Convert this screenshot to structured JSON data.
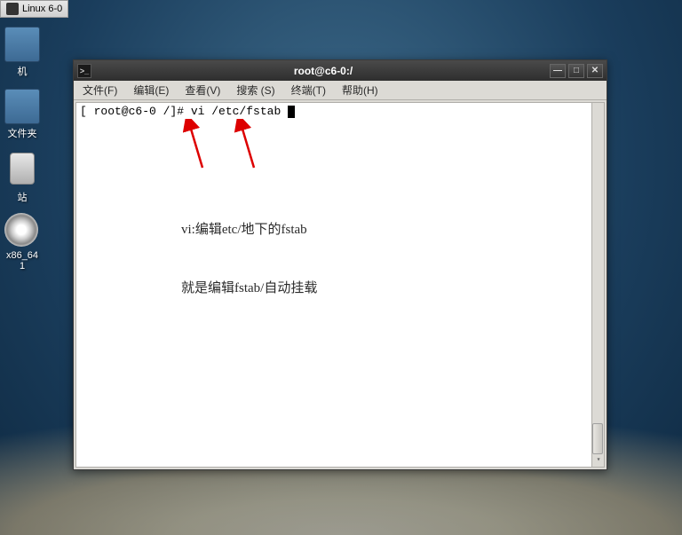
{
  "taskbar": {
    "item": "Linux 6-0"
  },
  "desktop": {
    "icons": {
      "computer": "机",
      "folder": "文件夹",
      "trash": "站",
      "disc": "x86_64\n1"
    }
  },
  "window": {
    "title": "root@c6-0:/",
    "menus": {
      "file": "文件(F)",
      "edit": "编辑(E)",
      "view": "查看(V)",
      "search": "搜索 (S)",
      "terminal": "终端(T)",
      "help": "帮助(H)"
    },
    "controls": {
      "min": "—",
      "max": "□",
      "close": "✕"
    }
  },
  "terminal": {
    "prompt": "[ root@c6-0 /]# ",
    "command": "vi /etc/fstab "
  },
  "annotation": {
    "line1": "vi:编辑etc/地下的fstab",
    "line2": "就是编辑fstab/自动挂载"
  }
}
